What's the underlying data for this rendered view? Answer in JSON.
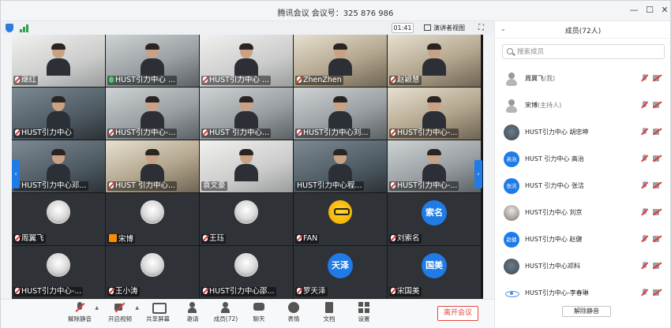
{
  "window": {
    "title": "腾讯会议 会议号：325 876 986",
    "minimize_icon": "minimize-icon",
    "maximize_icon": "maximize-icon",
    "close_icon": "close-icon"
  },
  "meeting_bar": {
    "timer": "01:41",
    "speaker_view": "演讲者视图",
    "fullscreen_icon": "fullscreen-icon"
  },
  "participants_grid": [
    {
      "name": "继红",
      "mic": "muted",
      "style": "video light"
    },
    {
      "name": "HUST引力中心 ...",
      "mic": "on",
      "style": "video"
    },
    {
      "name": "HUST引力中心 ...",
      "mic": "muted",
      "style": "video light"
    },
    {
      "name": "ZhenZhen",
      "mic": "muted",
      "style": "video warm"
    },
    {
      "name": "赵颖慧",
      "mic": "muted",
      "style": "video warm"
    },
    {
      "name": "HUST引力中心",
      "mic": "muted",
      "style": "video dark"
    },
    {
      "name": "HUST引力中心-...",
      "mic": "muted",
      "style": "video"
    },
    {
      "name": "HUST 引力中心...",
      "mic": "muted",
      "style": "video"
    },
    {
      "name": "HUST引力中心刘...",
      "mic": "muted",
      "style": "video"
    },
    {
      "name": "HUST引力中心-...",
      "mic": "muted",
      "style": "video warm"
    },
    {
      "name": "HUST引力中心邓...",
      "mic": "muted",
      "style": "video dark"
    },
    {
      "name": "HUST 引力中心...",
      "mic": "muted",
      "style": "video warm"
    },
    {
      "name": "袁文豪",
      "mic": "none",
      "style": "video light"
    },
    {
      "name": "HUST引力中心程...",
      "mic": "none",
      "style": "video dark"
    },
    {
      "name": "HUST引力中心-...",
      "mic": "muted",
      "style": "video"
    },
    {
      "name": "周翼飞",
      "mic": "muted",
      "avatar": "photo"
    },
    {
      "name": "宋博",
      "mic": "host",
      "avatar": "photo"
    },
    {
      "name": "王珏",
      "mic": "muted",
      "avatar": "photo"
    },
    {
      "name": "FAN",
      "mic": "muted",
      "avatar": "cartoon"
    },
    {
      "name": "刘索名",
      "mic": "muted",
      "avatar_text": "索名"
    },
    {
      "name": "HUST引力中心-...",
      "mic": "muted",
      "avatar": "photo"
    },
    {
      "name": "王小涛",
      "mic": "muted",
      "avatar": "photo"
    },
    {
      "name": "HUST引力中心邵...",
      "mic": "muted",
      "avatar": "photo"
    },
    {
      "name": "罗天泽",
      "mic": "muted",
      "avatar_text": "天泽"
    },
    {
      "name": "宋国美",
      "mic": "muted",
      "avatar_text": "国美"
    }
  ],
  "toolbar": {
    "unmute": "解除静音",
    "start_video": "开启视频",
    "share_screen": "共享屏幕",
    "invite": "邀请",
    "members": "成员(72)",
    "chat": "聊天",
    "reactions": "表情",
    "documents": "文档",
    "settings": "设置",
    "end_meeting": "离开会议"
  },
  "panel": {
    "title": "成员(72人)",
    "search_placeholder": "搜索成员",
    "unmute_all": "解除静音",
    "members": [
      {
        "name": "周翼飞",
        "role": "(我)",
        "avatar": "plain"
      },
      {
        "name": "宋博",
        "role": "(主持人)",
        "avatar": "plain"
      },
      {
        "name": "HUST引力中心 胡忠坤",
        "role": "",
        "avatar": "dark"
      },
      {
        "name": "HUST 引力中心 高治",
        "role": "",
        "avatar": "blue",
        "avatar_text": "高治"
      },
      {
        "name": "HUST 引力中心 张洁",
        "role": "",
        "avatar": "blue",
        "avatar_text": "张洁"
      },
      {
        "name": "HUST引力中心 刘京",
        "role": "",
        "avatar": "photo"
      },
      {
        "name": "HUST引力中心 赵健",
        "role": "",
        "avatar": "blue",
        "avatar_text": "赵健"
      },
      {
        "name": "HUST引力中心邓科",
        "role": "",
        "avatar": "dark"
      },
      {
        "name": "HUST引力中心-李春琳",
        "role": "",
        "avatar": "atom"
      }
    ]
  }
}
